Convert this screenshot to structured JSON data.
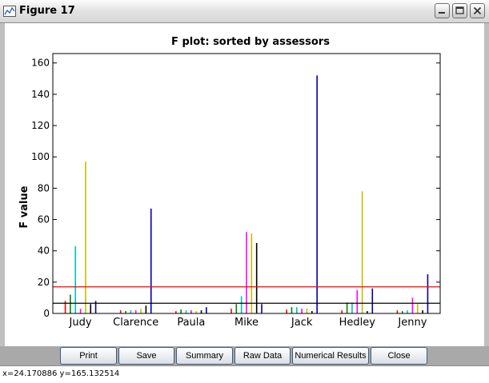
{
  "window": {
    "title": "Figure 17",
    "app_icon": "chart-window-icon",
    "controls": [
      "minimize-icon",
      "maximize-icon",
      "close-icon"
    ]
  },
  "buttons": {
    "print": "Print",
    "save": "Save",
    "summary": "Summary",
    "raw_data": "Raw Data",
    "numerical_results": "Numerical Results",
    "close": "Close"
  },
  "status": {
    "coords": "x=24.170886  y=165.132514"
  },
  "chart_data": {
    "type": "bar",
    "title": "F plot: sorted by assessors",
    "xlabel": "",
    "ylabel": "F value",
    "ylim": [
      0,
      166
    ],
    "yticks": [
      0,
      20,
      40,
      60,
      80,
      100,
      120,
      140,
      160
    ],
    "grid": false,
    "legend": "none",
    "categories": [
      "Judy",
      "Clarence",
      "Paula",
      "Mike",
      "Jack",
      "Hedley",
      "Jenny"
    ],
    "reference_lines": [
      {
        "value": 17,
        "color": "#ff0000"
      },
      {
        "value": 6.5,
        "color": "#000000"
      }
    ],
    "bar_colors": [
      "#ff0000",
      "#008000",
      "#00bfbf",
      "#ff00ff",
      "#c0c000",
      "#000000",
      "#0000aa"
    ],
    "values": [
      [
        8,
        12,
        43,
        3,
        97,
        6,
        8
      ],
      [
        2,
        1.5,
        2,
        2,
        3,
        5,
        67
      ],
      [
        1.5,
        2.5,
        2,
        1.5,
        1.5,
        2,
        4
      ],
      [
        3,
        6,
        11,
        52,
        51,
        45,
        6
      ],
      [
        2.5,
        4,
        4,
        3,
        3,
        1.5,
        152
      ],
      [
        2,
        7,
        7,
        15,
        78,
        1.5,
        16
      ],
      [
        2,
        1.5,
        2,
        10,
        6,
        2,
        25
      ]
    ]
  }
}
